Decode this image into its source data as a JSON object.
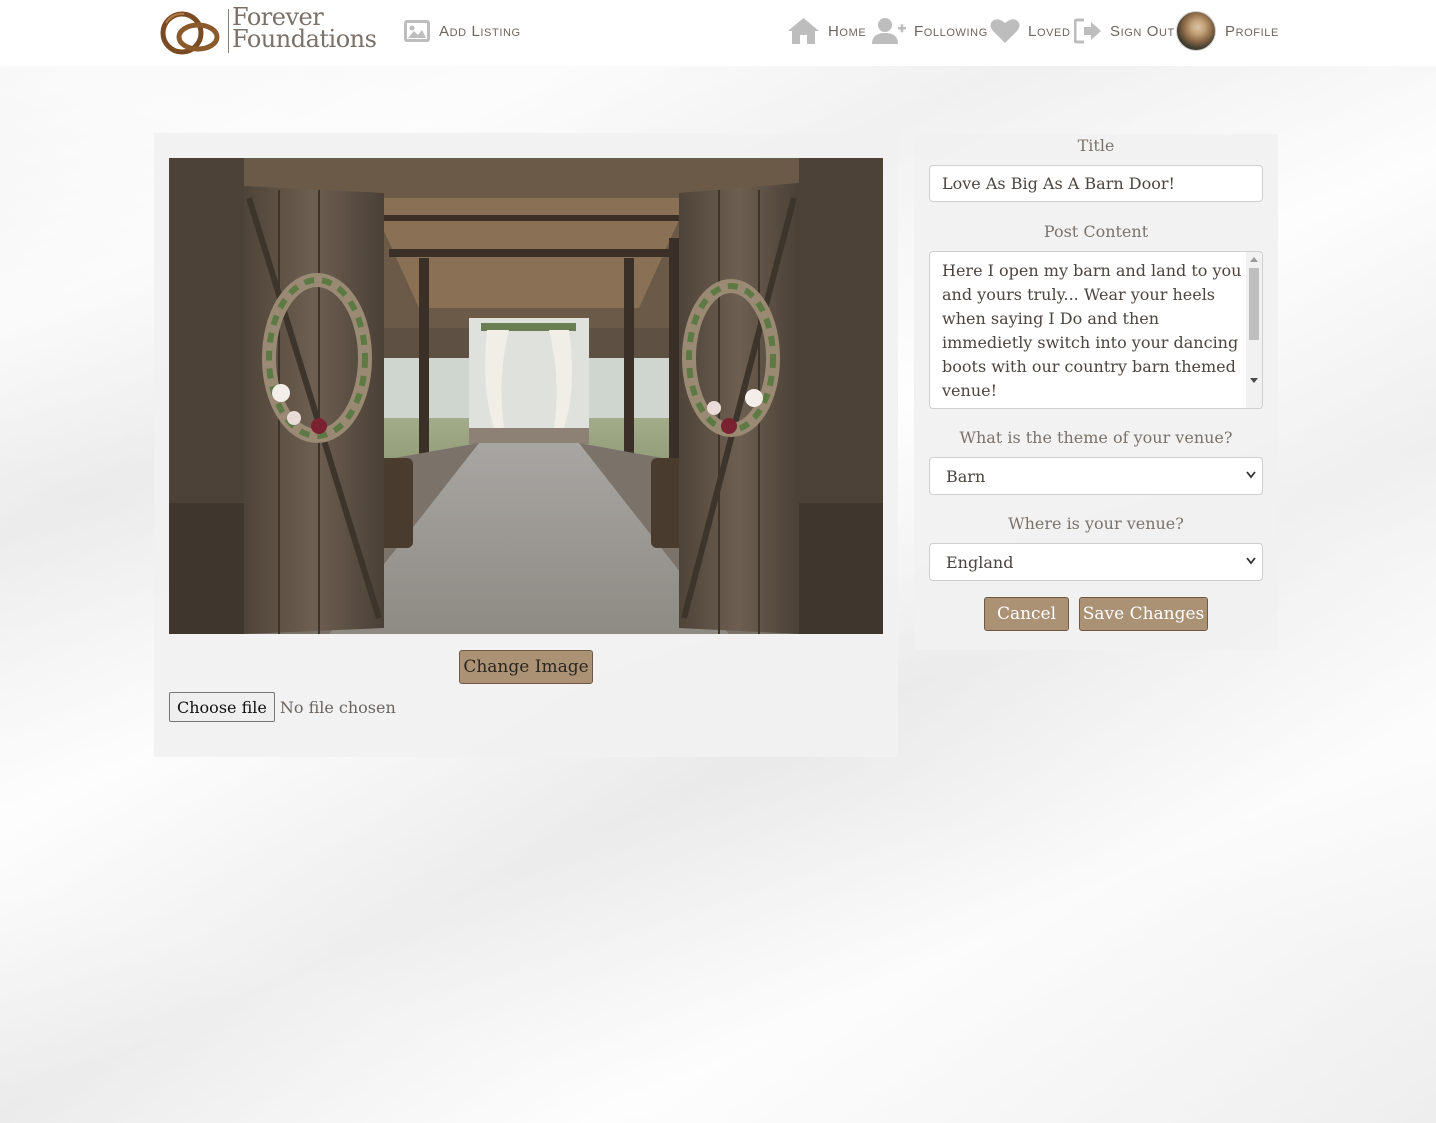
{
  "brand": {
    "line1": "Forever",
    "line2": "Foundations"
  },
  "nav": {
    "add_listing": "Add Listing",
    "home": "Home",
    "following": "Following",
    "loved": "Loved",
    "sign_out": "Sign Out",
    "profile": "Profile"
  },
  "image_panel": {
    "change_image_label": "Change Image",
    "choose_file_label": "Choose file",
    "file_status": "No file chosen"
  },
  "form": {
    "title_label": "Title",
    "title_value": "Love As Big As A Barn Door!",
    "content_label": "Post Content",
    "content_value": "Here I open my barn and land to you and yours truly... Wear your heels when saying I Do and then immedietly switch into your dancing boots with our country barn themed venue!",
    "theme_label": "What is the theme of your venue?",
    "theme_value": "Barn",
    "location_label": "Where is your venue?",
    "location_value": "England",
    "cancel_label": "Cancel",
    "save_label": "Save Changes"
  },
  "colors": {
    "button_fill": "#ab9275",
    "button_border": "#6e5a44",
    "logo_ring": "#7a4a22",
    "text_muted": "#7a736d"
  },
  "icons": [
    "image-icon",
    "home-icon",
    "add-user-icon",
    "heart-icon",
    "sign-out-icon",
    "ring-logo-icon"
  ]
}
